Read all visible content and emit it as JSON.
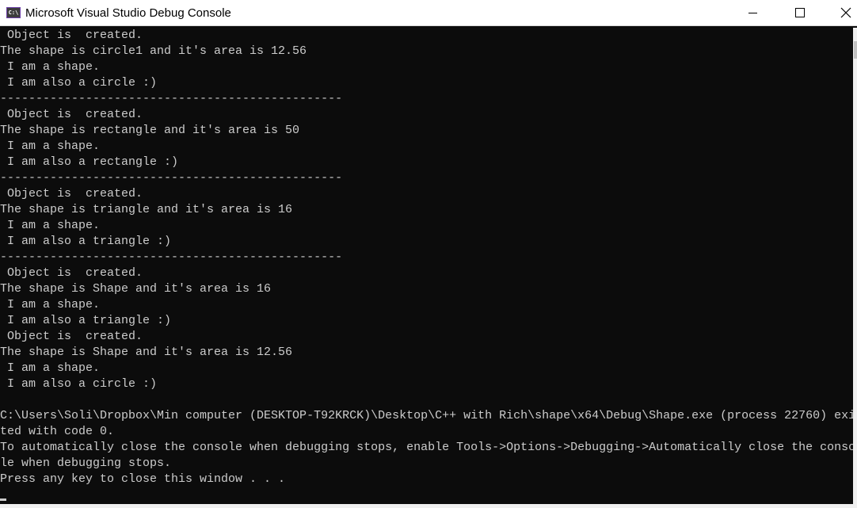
{
  "window": {
    "title": "Microsoft Visual Studio Debug Console",
    "icon_glyph": "C:\\",
    "icons": {
      "app": "console-app-icon",
      "minimize": "minimize-icon",
      "maximize": "maximize-icon",
      "close": "close-icon"
    }
  },
  "console": {
    "lines": [
      " Object is  created.",
      "The shape is circle1 and it's area is 12.56",
      " I am a shape.",
      " I am also a circle :)",
      "------------------------------------------------",
      " Object is  created.",
      "The shape is rectangle and it's area is 50",
      " I am a shape.",
      " I am also a rectangle :)",
      "------------------------------------------------",
      " Object is  created.",
      "The shape is triangle and it's area is 16",
      " I am a shape.",
      " I am also a triangle :)",
      "------------------------------------------------",
      " Object is  created.",
      "The shape is Shape and it's area is 16",
      " I am a shape.",
      " I am also a triangle :)",
      " Object is  created.",
      "The shape is Shape and it's area is 12.56",
      " I am a shape.",
      " I am also a circle :)",
      "",
      "C:\\Users\\Soli\\Dropbox\\Min computer (DESKTOP-T92KRCK)\\Desktop\\C++ with Rich\\shape\\x64\\Debug\\Shape.exe (process 22760) exi",
      "ted with code 0.",
      "To automatically close the console when debugging stops, enable Tools->Options->Debugging->Automatically close the conso",
      "le when debugging stops.",
      "Press any key to close this window . . ."
    ]
  },
  "colors": {
    "console_bg": "#0c0c0c",
    "console_text": "#cccccc",
    "titlebar_bg": "#ffffff"
  }
}
